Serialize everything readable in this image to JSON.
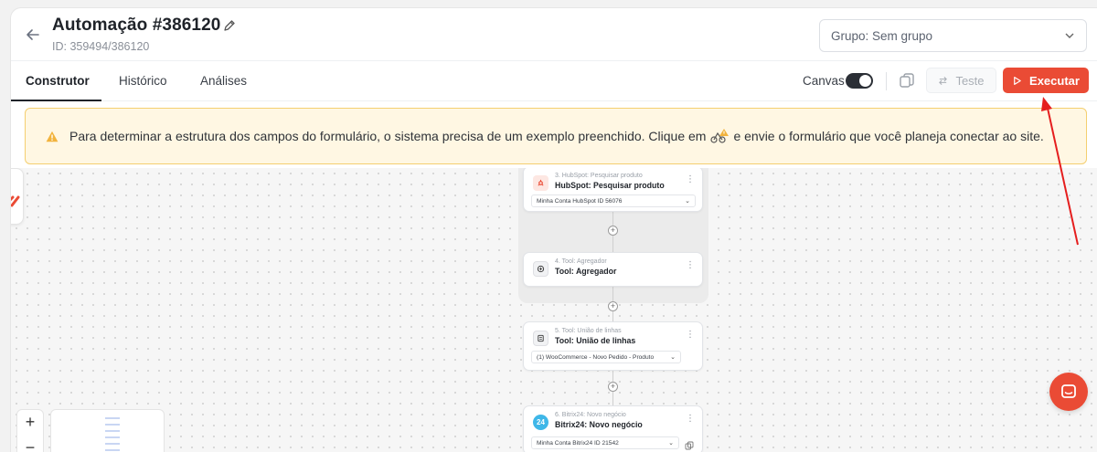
{
  "header": {
    "title": "Automação #386120",
    "id_text": "ID: 359494/386120",
    "group_select": "Grupo: Sem grupo"
  },
  "tabs": [
    {
      "label": "Construtor",
      "active": true
    },
    {
      "label": "Histórico",
      "active": false
    },
    {
      "label": "Análises",
      "active": false
    }
  ],
  "toolbar": {
    "canvas_label": "Canvas",
    "canvas_on": true,
    "test_label": "Teste",
    "run_label": "Executar"
  },
  "warning": {
    "text_before": "Para determinar a estrutura dos campos do formulário, o sistema precisa de um exemplo preenchido. Clique em",
    "text_after": "e envie o formulário que você planeja conectar ao site."
  },
  "nodes": [
    {
      "subtitle": "3. HubSpot: Pesquisar produto",
      "title": "HubSpot: Pesquisar produto",
      "select": "Minha Conta HubSpot ID 56076",
      "icon": "hubspot-icon"
    },
    {
      "subtitle": "4. Tool: Agregador",
      "title": "Tool: Agregador",
      "icon": "aggregator-icon"
    },
    {
      "subtitle": "5. Tool: União de linhas",
      "title": "Tool: União de linhas",
      "select": "(1) WooCommerce - Novo Pedido - Produto",
      "icon": "merge-lines-icon"
    },
    {
      "subtitle": "6. Bitrix24: Novo negócio",
      "title": "Bitrix24: Novo negócio",
      "select": "Minha Conta Bitrix24 ID 21542",
      "icon": "bitrix24-icon",
      "icon_text": "24"
    }
  ],
  "zoom": {
    "in": "+",
    "out": "−"
  },
  "colors": {
    "accent": "#ea4b35",
    "warning_bg": "#fff7e3",
    "warning_border": "#f4cf70"
  }
}
